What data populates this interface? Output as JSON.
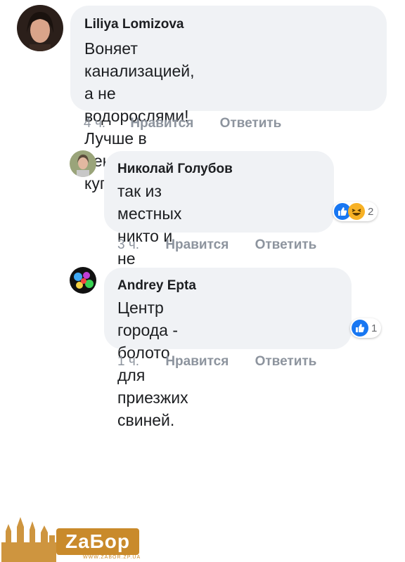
{
  "comments": [
    {
      "author": "Liliya Lomizova",
      "text_lines": [
        "Воняет канализацией, а не",
        "водорослями! Лучше в центре не",
        "купаться!"
      ],
      "time": "4 ч.",
      "like_label": "Нравится",
      "reply_label": "Ответить"
    },
    {
      "author": "Николай Голубов",
      "text_lines": [
        "так из местных никто и",
        "не купается"
      ],
      "time": "3 ч.",
      "like_label": "Нравится",
      "reply_label": "Ответить",
      "reactions": {
        "count": "2",
        "icons": [
          "like-icon",
          "laugh-icon"
        ]
      }
    },
    {
      "author": "Andrey Epta",
      "text_lines": [
        "Центр города - болото для",
        "приезжих свиней."
      ],
      "time": "1 ч.",
      "like_label": "Нравится",
      "reply_label": "Ответить",
      "reactions": {
        "count": "1",
        "icons": [
          "like-icon"
        ]
      }
    }
  ],
  "watermark": {
    "text": "ZаБор",
    "subtext": "WWW.ZABOR.ZP.UA"
  },
  "colors": {
    "bubble": "#f0f2f5",
    "meta": "#8d949e",
    "like_blue": "#1877f2",
    "laugh_yellow": "#f7b125",
    "logo": "#c98a2b"
  }
}
